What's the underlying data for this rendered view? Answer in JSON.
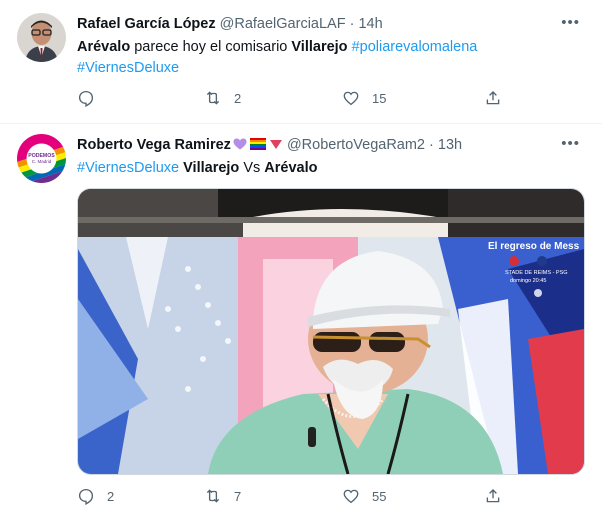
{
  "tweets": [
    {
      "name": "Rafael García López",
      "handle": "@RafaelGarciaLAF",
      "separator": "·",
      "time": "14h",
      "text_parts": [
        "Arévalo",
        " parece hoy el comisario ",
        "Villarejo",
        " ",
        "#poliarevalomalena",
        "#ViernesDeluxe"
      ],
      "stats": {
        "replies": "",
        "retweets": "2",
        "likes": "15"
      }
    },
    {
      "name": "Roberto Vega Ramirez",
      "handle": "@RobertoVegaRam2",
      "separator": "·",
      "time": "13h",
      "text_parts": [
        "#ViernesDeluxe",
        " ",
        "Villarejo",
        " Vs ",
        "Arévalo"
      ],
      "stats": {
        "replies": "2",
        "retweets": "7",
        "likes": "55"
      },
      "avatar_text": [
        "PODEMOS",
        "C. Madrid"
      ],
      "media_text": {
        "screen_title": "El regreso de Mess",
        "screen_line1": "STADE DE REIMS - PSG",
        "screen_line2": "domingo 20:45"
      }
    }
  ],
  "icons": {
    "more": "more-icon",
    "reply": "reply-icon",
    "retweet": "retweet-icon",
    "like": "heart-icon",
    "share": "share-icon"
  },
  "colors": {
    "link": "#1d9bf0",
    "muted": "#536471",
    "text": "#0f1419"
  }
}
